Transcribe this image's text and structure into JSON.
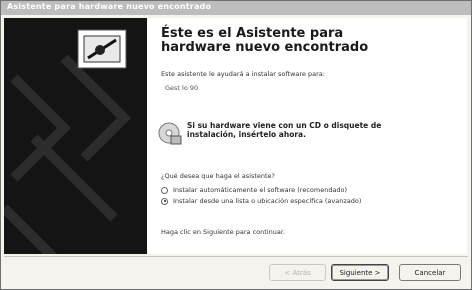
{
  "window": {
    "title": "Asistente para hardware nuevo encontrado"
  },
  "content": {
    "heading": "Éste es el Asistente para hardware nuevo encontrado",
    "intro": "Este asistente le ayudará a instalar software para:",
    "device": "Gest lo 90",
    "cd_notice": "Si su hardware viene con un CD o disquete de instalación, insértelo ahora.",
    "question": "¿Qué desea que haga el asistente?",
    "options": [
      {
        "label": "Instalar automáticamente el software (recomendado)",
        "selected": false
      },
      {
        "label": "Instalar desde una lista o ubicación específica (avanzado)",
        "selected": true
      }
    ],
    "continue_hint": "Haga clic en Siguiente para continuar."
  },
  "buttons": {
    "back": "< Atrás",
    "next": "Siguiente >",
    "cancel": "Cancelar"
  },
  "icons": {
    "wizard": "hardware-install-icon",
    "cd": "cd-disk-icon"
  }
}
